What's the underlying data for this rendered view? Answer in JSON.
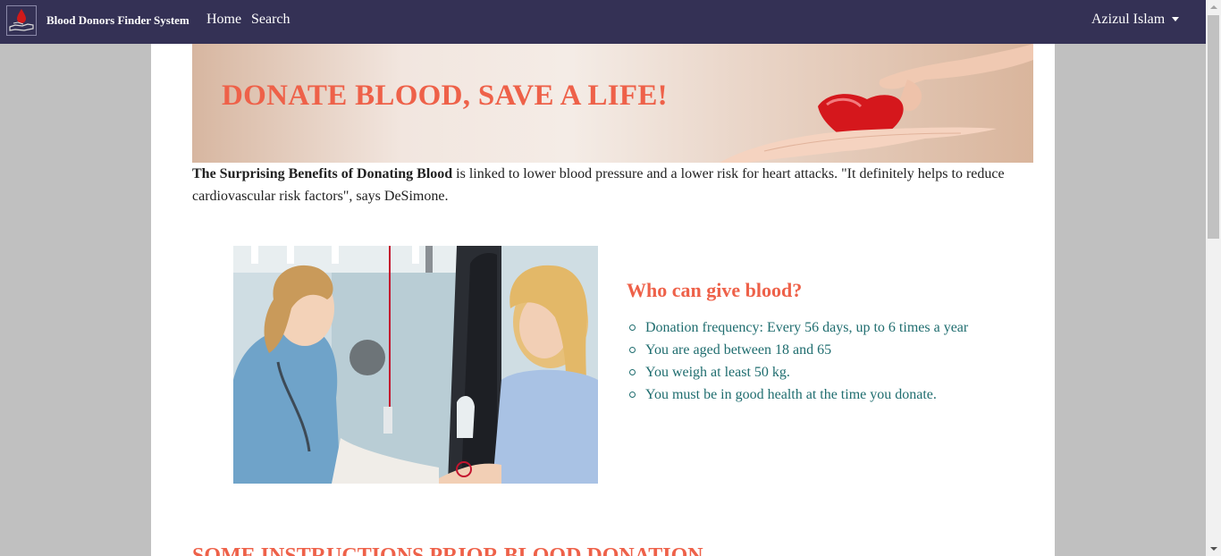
{
  "navbar": {
    "brand": "Blood Donors Finder System",
    "links": {
      "home": "Home",
      "search": "Search"
    },
    "user": "Azizul Islam"
  },
  "banner": {
    "title": "DONATE BLOOD, SAVE A LIFE!"
  },
  "intro": {
    "bold": "The Surprising Benefits of Donating Blood",
    "text": " is linked to lower blood pressure and a lower risk for heart attacks. \"It definitely helps to reduce cardiovascular risk factors\", says DeSimone."
  },
  "who": {
    "title": "Who can give blood?",
    "items": [
      "Donation frequency: Every 56 days, up to 6 times a year",
      "You are aged between 18 and 65",
      "You weigh at least 50 kg.",
      "You must be in good health at the time you donate."
    ]
  },
  "instructions": {
    "title": "SOME INSTRUCTIONS PRIOR BLOOD DONATION"
  },
  "colors": {
    "navbar": "#343155",
    "accent": "#ee6149",
    "list_text": "#1f6d6f"
  }
}
